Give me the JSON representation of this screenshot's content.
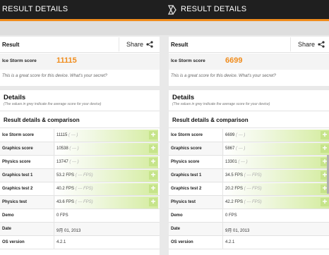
{
  "screens": [
    {
      "title": "RESULT DETAILS",
      "result_label": "Result",
      "share_label": "Share",
      "score_label": "Ice Storm score",
      "score_value": "11115",
      "message": "This is a great score for this device. What's your secret?",
      "details_title": "Details",
      "details_subtitle": "(The values in grey indicate the average score for your device)",
      "comparison_title": "Result details & comparison",
      "rows": [
        {
          "label": "Ice Storm score",
          "value": "11115",
          "avg": "( --- )",
          "plus": true
        },
        {
          "label": "Graphics score",
          "value": "10538",
          "avg": "( --- )",
          "plus": true
        },
        {
          "label": "Physics score",
          "value": "13747",
          "avg": "( --- )",
          "plus": true
        },
        {
          "label": "Graphics test 1",
          "value": "53.2 FPS",
          "avg": "( --- FPS)",
          "plus": true
        },
        {
          "label": "Graphics test 2",
          "value": "40.2 FPS",
          "avg": "( --- FPS)",
          "plus": true
        },
        {
          "label": "Physics test",
          "value": "43.6 FPS",
          "avg": "( --- FPS)",
          "plus": true
        },
        {
          "label": "Demo",
          "value": "0 FPS",
          "avg": "",
          "plus": false
        },
        {
          "label": "Date",
          "value": "9月 01, 2013",
          "avg": "",
          "plus": false
        },
        {
          "label": "OS version",
          "value": "4.2.1",
          "avg": "",
          "plus": false
        }
      ]
    },
    {
      "title": "RESULT DETAILS",
      "result_label": "Result",
      "share_label": "Share",
      "score_label": "Ice Storm score",
      "score_value": "6699",
      "message": "This is a great score for this device. What's your secret?",
      "details_title": "Details",
      "details_subtitle": "(The values in grey indicate the average score for your device)",
      "comparison_title": "Result details & comparison",
      "rows": [
        {
          "label": "Ice Storm score",
          "value": "6699",
          "avg": "( --- )",
          "plus": true
        },
        {
          "label": "Graphics score",
          "value": "5867",
          "avg": "( --- )",
          "plus": true
        },
        {
          "label": "Physics score",
          "value": "13301",
          "avg": "( --- )",
          "plus": true
        },
        {
          "label": "Graphics test 1",
          "value": "34.5 FPS",
          "avg": "( --- FPS)",
          "plus": true
        },
        {
          "label": "Graphics test 2",
          "value": "20.2 FPS",
          "avg": "( --- FPS)",
          "plus": true
        },
        {
          "label": "Physics test",
          "value": "42.2 FPS",
          "avg": "( --- FPS)",
          "plus": true
        },
        {
          "label": "Demo",
          "value": "0 FPS",
          "avg": "",
          "plus": false
        },
        {
          "label": "Date",
          "value": "9月 01, 2013",
          "avg": "",
          "plus": false
        },
        {
          "label": "OS version",
          "value": "4.2.1",
          "avg": "",
          "plus": false
        }
      ]
    }
  ],
  "colors": {
    "accent": "#f08c1c",
    "topbar": "#1f1f1f",
    "bar_green": "#c6e48a"
  },
  "icons": {
    "logo": "3dmark-logo-icon",
    "share": "share-icon",
    "expand": "plus-icon"
  }
}
